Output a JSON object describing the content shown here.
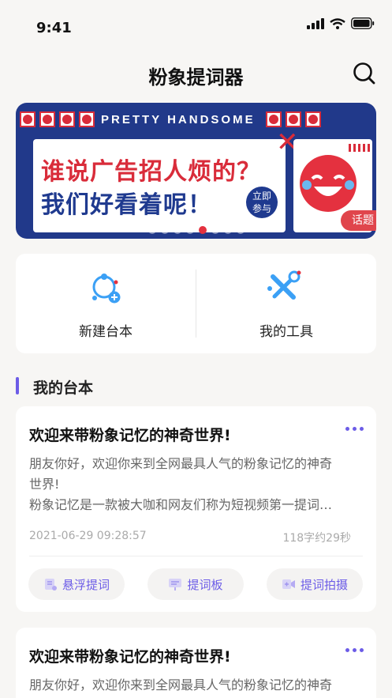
{
  "status_bar": {
    "time": "9:41"
  },
  "nav": {
    "title": "粉象提词器"
  },
  "banner": {
    "caption": "PRETTY HANDSOME",
    "line1": "谁说广告招人烦的？",
    "line2": "我们好看着呢！",
    "badge": "立即参与",
    "tag": "话题",
    "slide_count": 8,
    "active_slide": 5
  },
  "tools": [
    {
      "label": "新建台本",
      "icon": "new-script-icon"
    },
    {
      "label": "我的工具",
      "icon": "tools-icon"
    }
  ],
  "section": {
    "title": "我的台本"
  },
  "scripts": [
    {
      "title": "欢迎来带粉象记忆的神奇世界!",
      "body_line1": "朋友你好，欢迎你来到全网最具人气的粉象记忆的神奇",
      "body_line2": "世界!",
      "body_line3": "粉象记忆是一款被大咖和网友们称为短视频第一提词…",
      "date": "2021-06-29 09:28:57",
      "words": "118字约29秒",
      "actions": [
        "悬浮提词",
        "提词板",
        "提词拍摄"
      ]
    },
    {
      "title": "欢迎来带粉象记忆的神奇世界!",
      "body_line1": "朋友你好，欢迎你来到全网最具人气的粉象记忆的神奇"
    }
  ],
  "colors": {
    "accent": "#6c5ce7",
    "banner_blue": "#21398a",
    "banner_red": "#d92c3a"
  }
}
